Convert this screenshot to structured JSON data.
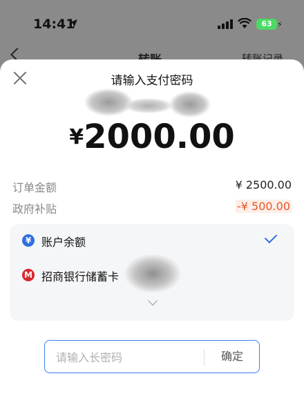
{
  "status_bar": {
    "time": "14:41",
    "battery": "63"
  },
  "background_page": {
    "title": "转账",
    "right_link": "转账记录"
  },
  "sheet": {
    "title": "请输入支付密码",
    "amount_currency": "¥",
    "amount_value": "2000.00",
    "rows": [
      {
        "label": "订单金额",
        "value": "¥ 2500.00"
      },
      {
        "label": "政府补贴",
        "value": "-¥ 500.00"
      }
    ],
    "methods": [
      {
        "icon": "yuan-icon",
        "icon_glyph": "¥",
        "icon_color": "#2f6fe0",
        "label": "账户余额",
        "selected": true
      },
      {
        "icon": "cmb-bank-icon",
        "icon_glyph": "M",
        "icon_color": "#d9262c",
        "label": "招商银行储蓄卡",
        "selected": false
      }
    ],
    "password": {
      "placeholder": "请输入长密码",
      "value": "",
      "confirm_label": "确定"
    }
  },
  "colors": {
    "accent": "#2f6fe0",
    "discount": "#e8572a",
    "bank_red": "#d9262c",
    "battery_green": "#4cd964"
  }
}
